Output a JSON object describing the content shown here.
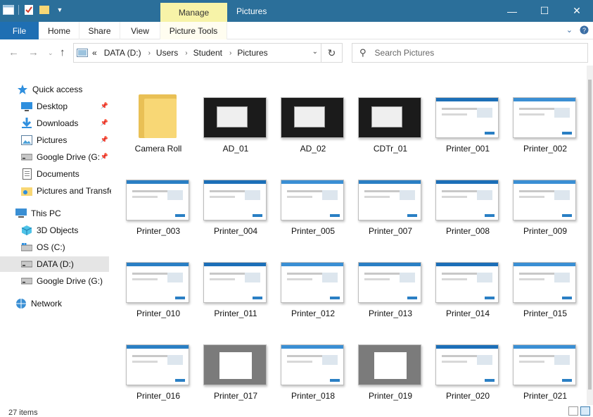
{
  "titlebar": {
    "manage_tab": "Manage",
    "title": "Pictures",
    "accent": "#2b6f9a"
  },
  "window_buttons": {
    "minimize": "—",
    "maximize": "☐",
    "close": "✕"
  },
  "ribbon": {
    "tabs": [
      {
        "label": "File"
      },
      {
        "label": "Home"
      },
      {
        "label": "Share"
      },
      {
        "label": "View"
      },
      {
        "label": "Picture Tools"
      }
    ],
    "expand_icon": "chevron-down-icon",
    "help_icon": "help-icon"
  },
  "address": {
    "overflow": "«",
    "segments": [
      "DATA (D:)",
      "Users",
      "Student",
      "Pictures"
    ]
  },
  "search": {
    "placeholder": "Search Pictures"
  },
  "nav": {
    "quick_access": "Quick access",
    "items": [
      {
        "label": "Desktop",
        "icon": "desktop-icon",
        "pinned": true
      },
      {
        "label": "Downloads",
        "icon": "download-icon",
        "pinned": true
      },
      {
        "label": "Pictures",
        "icon": "pictures-icon",
        "pinned": true
      },
      {
        "label": "Google Drive (G:",
        "icon": "drive-icon",
        "pinned": true
      },
      {
        "label": "Documents",
        "icon": "documents-icon",
        "pinned": false
      },
      {
        "label": "Pictures and Transfe",
        "icon": "folder-icon",
        "pinned": false
      }
    ],
    "this_pc": "This PC",
    "pc_items": [
      {
        "label": "3D Objects",
        "icon": "cube-icon"
      },
      {
        "label": "OS (C:)",
        "icon": "windows-drive-icon"
      },
      {
        "label": "DATA (D:)",
        "icon": "drive-icon"
      },
      {
        "label": "Google Drive (G:)",
        "icon": "drive-icon"
      }
    ],
    "network": "Network"
  },
  "files": [
    {
      "name": "Camera Roll",
      "kind": "folder"
    },
    {
      "name": "AD_01",
      "kind": "dark"
    },
    {
      "name": "AD_02",
      "kind": "dark"
    },
    {
      "name": "CDTr_01",
      "kind": "dark"
    },
    {
      "name": "Printer_001",
      "kind": "light"
    },
    {
      "name": "Printer_002",
      "kind": "light"
    },
    {
      "name": "Printer_003",
      "kind": "light"
    },
    {
      "name": "Printer_004",
      "kind": "light"
    },
    {
      "name": "Printer_005",
      "kind": "light"
    },
    {
      "name": "Printer_007",
      "kind": "light"
    },
    {
      "name": "Printer_008",
      "kind": "light"
    },
    {
      "name": "Printer_009",
      "kind": "light"
    },
    {
      "name": "Printer_010",
      "kind": "light"
    },
    {
      "name": "Printer_011",
      "kind": "light"
    },
    {
      "name": "Printer_012",
      "kind": "light"
    },
    {
      "name": "Printer_013",
      "kind": "light"
    },
    {
      "name": "Printer_014",
      "kind": "light"
    },
    {
      "name": "Printer_015",
      "kind": "light"
    },
    {
      "name": "Printer_016",
      "kind": "light"
    },
    {
      "name": "Printer_017",
      "kind": "gray"
    },
    {
      "name": "Printer_018",
      "kind": "light"
    },
    {
      "name": "Printer_019",
      "kind": "gray"
    },
    {
      "name": "Printer_020",
      "kind": "light"
    },
    {
      "name": "Printer_021",
      "kind": "light"
    }
  ],
  "status": {
    "count": "27 items"
  }
}
